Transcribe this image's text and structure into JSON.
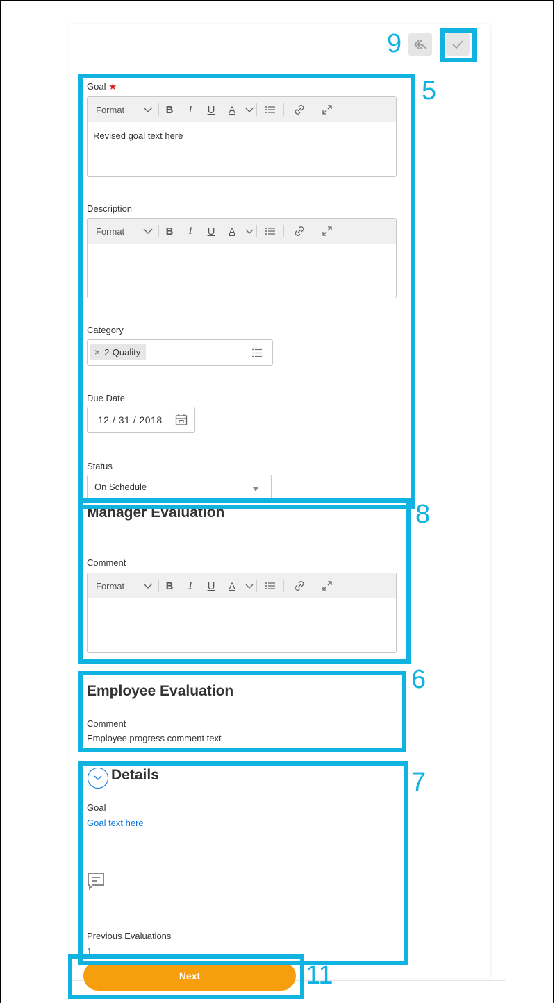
{
  "header": {
    "reply_icon": "reply-arrow-icon",
    "confirm_icon": "checkmark-icon"
  },
  "callouts": {
    "five": "5",
    "six": "6",
    "seven": "7",
    "eight": "8",
    "nine": "9",
    "eleven": "11"
  },
  "toolbar": {
    "format_label": "Format",
    "bold": "B",
    "italic": "I",
    "underline": "U",
    "color": "A"
  },
  "goal": {
    "label": "Goal",
    "required_marker": "★",
    "value": "Revised goal text here"
  },
  "description": {
    "label": "Description",
    "value": ""
  },
  "category": {
    "label": "Category",
    "selected": "2-Quality",
    "remove_glyph": "×"
  },
  "due_date": {
    "label": "Due Date",
    "value": "12 / 31 / 2018"
  },
  "status": {
    "label": "Status",
    "value": "On Schedule"
  },
  "manager_evaluation": {
    "title": "Manager Evaluation",
    "comment_label": "Comment",
    "comment_value": ""
  },
  "employee_evaluation": {
    "title": "Employee Evaluation",
    "comment_label": "Comment",
    "comment_value": "Employee progress comment text"
  },
  "details": {
    "title": "Details",
    "goal_label": "Goal",
    "goal_link": "Goal text here",
    "previous_label": "Previous Evaluations",
    "previous_value": "1"
  },
  "footer": {
    "next_label": "Next"
  },
  "colors": {
    "highlight": "#10b3e0",
    "accent": "#f79e0f",
    "link": "#0875e1",
    "required": "#e01b1b"
  }
}
